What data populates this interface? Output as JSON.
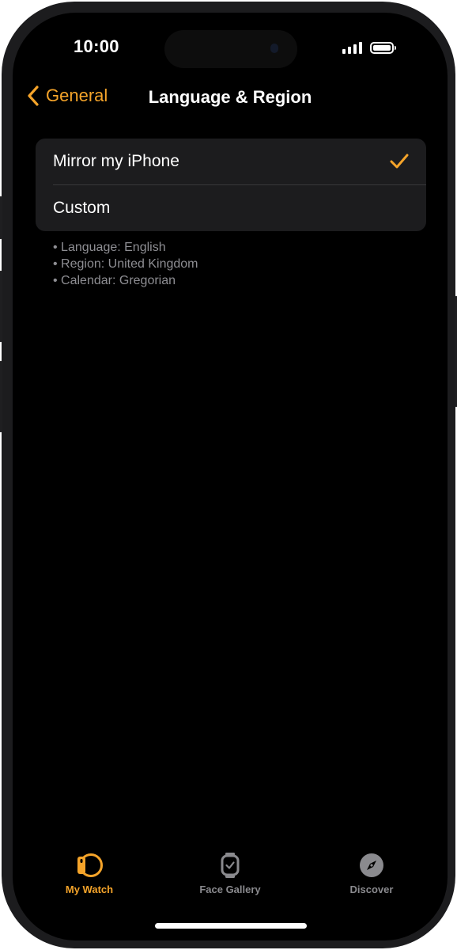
{
  "status_bar": {
    "time": "10:00"
  },
  "nav": {
    "back_label": "General",
    "title": "Language & Region"
  },
  "options": [
    {
      "label": "Mirror my iPhone",
      "selected": true
    },
    {
      "label": "Custom",
      "selected": false
    }
  ],
  "details": [
    "• Language: English",
    "• Region: United Kingdom",
    "• Calendar: Gregorian"
  ],
  "tabs": [
    {
      "label": "My Watch",
      "icon": "watch-icon",
      "active": true
    },
    {
      "label": "Face Gallery",
      "icon": "face-gallery-icon",
      "active": false
    },
    {
      "label": "Discover",
      "icon": "compass-icon",
      "active": false
    }
  ],
  "colors": {
    "accent": "#f5a42a",
    "inactive": "#8a8a8e",
    "background": "#000000",
    "cell": "#1c1c1e"
  }
}
